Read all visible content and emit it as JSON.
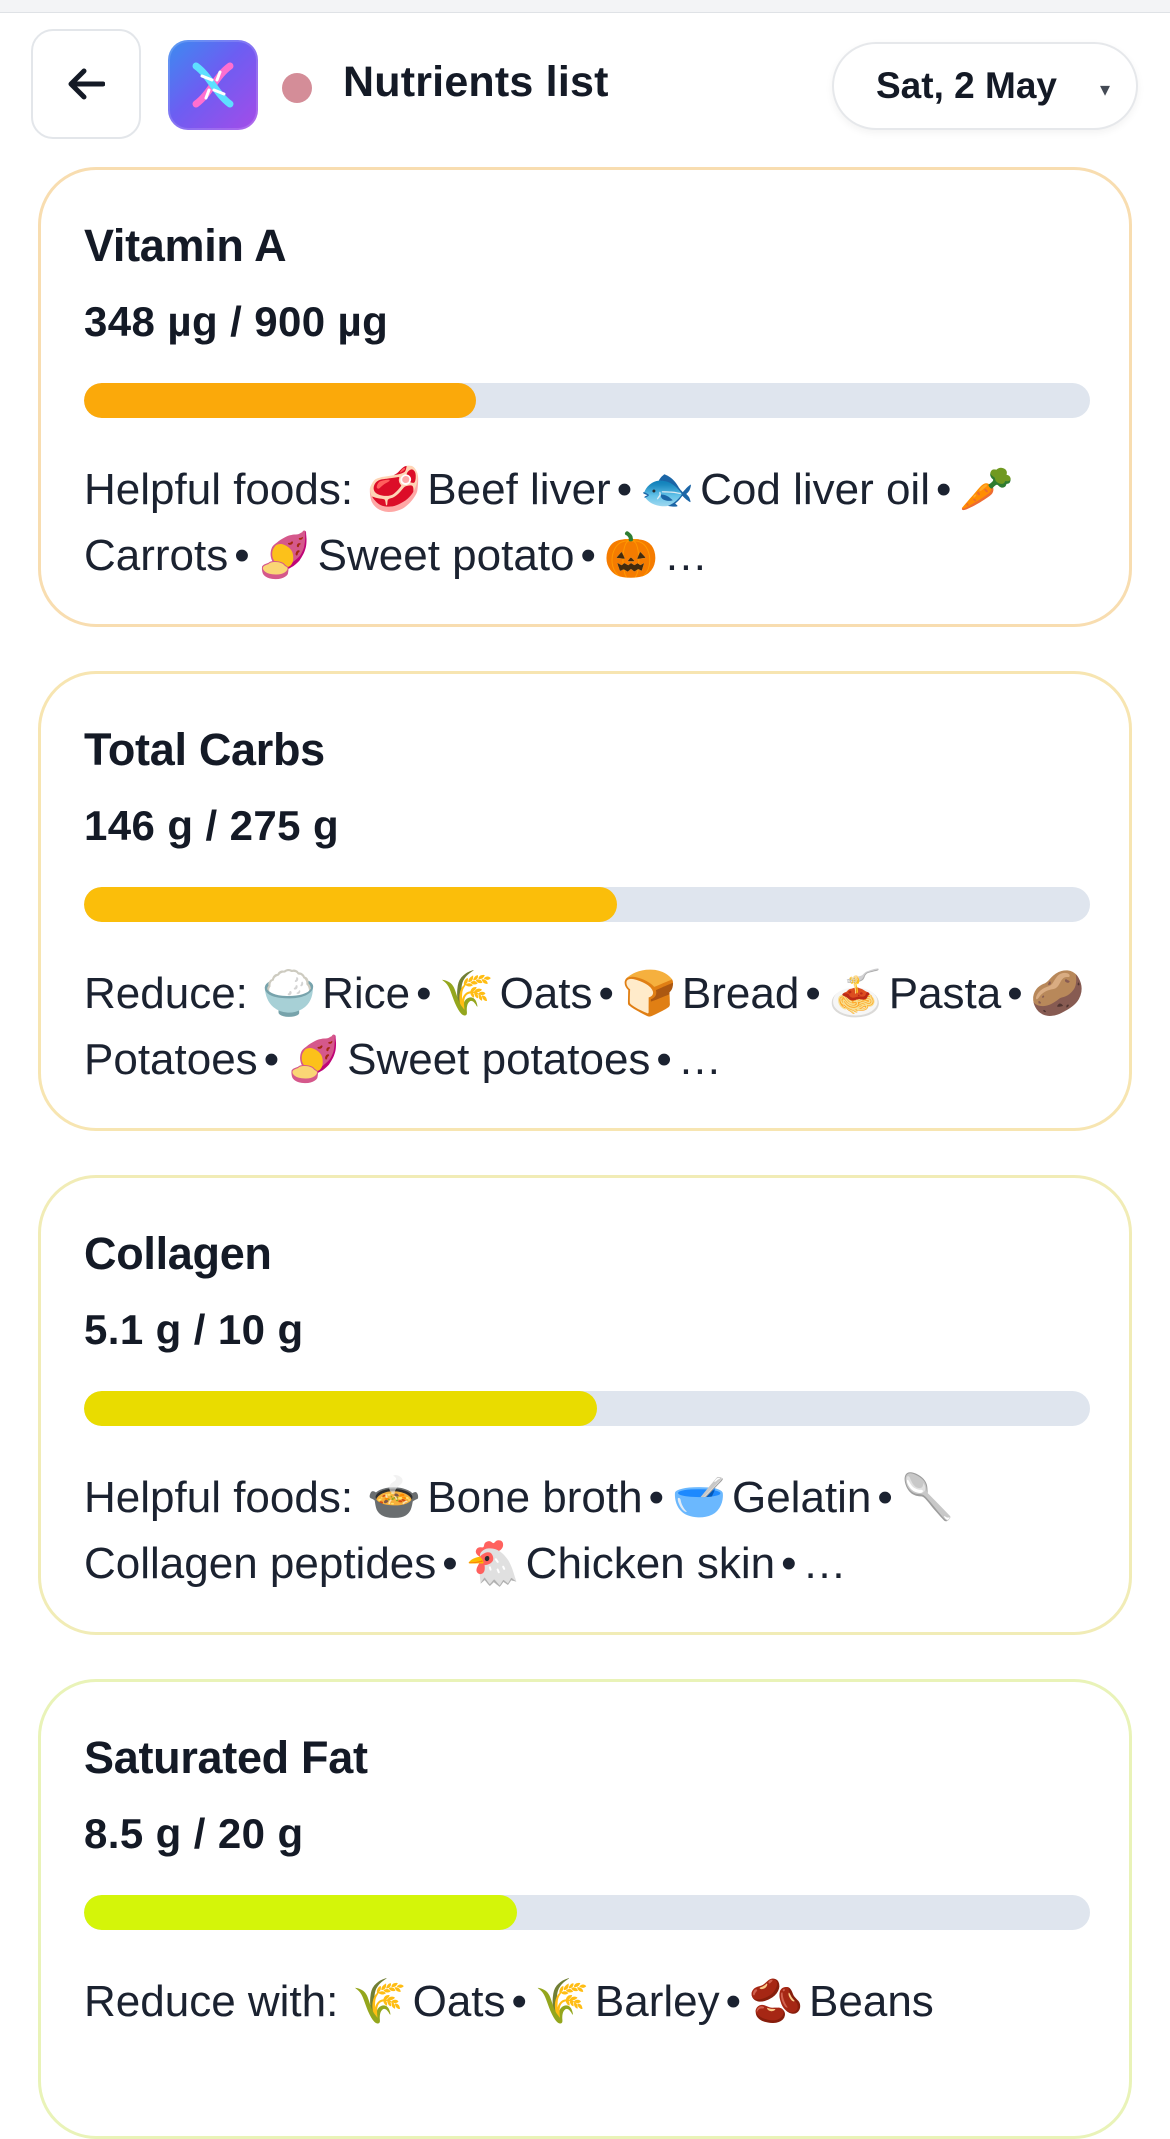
{
  "header": {
    "back_label": "←",
    "title": "Nutrients list",
    "date": "Sat, 2 May",
    "caret": "▾",
    "status_dot_color": "#d48d98",
    "icon": "dna-icon"
  },
  "cards": [
    {
      "name": "Vitamin A",
      "amount": "348 µg / 900 µg",
      "progress": 0.39,
      "bar_color": "#fba90a",
      "border_color": "#f8ddb0",
      "foods_label": "Helpful foods:",
      "foods": [
        {
          "emoji": "🥩",
          "name": "Beef liver"
        },
        {
          "emoji": "🐟",
          "name": "Cod liver oil"
        },
        {
          "emoji": "🥕",
          "name": "Carrots"
        },
        {
          "emoji": "🍠",
          "name": "Sweet potato"
        },
        {
          "emoji": "🎃",
          "name": "…"
        }
      ]
    },
    {
      "name": "Total Carbs",
      "amount": "146 g / 275 g",
      "progress": 0.53,
      "bar_color": "#fbbe0a",
      "border_color": "#f7e5b1",
      "foods_label": "Reduce:",
      "foods": [
        {
          "emoji": "🍚",
          "name": "Rice"
        },
        {
          "emoji": "🌾",
          "name": "Oats"
        },
        {
          "emoji": "🍞",
          "name": "Bread"
        },
        {
          "emoji": "🍝",
          "name": "Pasta"
        },
        {
          "emoji": "🥔",
          "name": "Potatoes"
        },
        {
          "emoji": "🍠",
          "name": "Sweet potatoes"
        },
        {
          "emoji": "",
          "name": "…"
        }
      ]
    },
    {
      "name": "Collagen",
      "amount": "5.1 g / 10 g",
      "progress": 0.51,
      "bar_color": "#e9dc00",
      "border_color": "#f1ecb6",
      "foods_label": "Helpful foods:",
      "foods": [
        {
          "emoji": "🍲",
          "name": "Bone broth"
        },
        {
          "emoji": "🥣",
          "name": "Gelatin"
        },
        {
          "emoji": "🥄",
          "name": "Collagen peptides"
        },
        {
          "emoji": "🐔",
          "name": "Chicken skin"
        },
        {
          "emoji": "",
          "name": "…"
        }
      ]
    },
    {
      "name": "Saturated Fat",
      "amount": "8.5 g / 20 g",
      "progress": 0.43,
      "bar_color": "#d4f509",
      "border_color": "#e9f3b8",
      "foods_label": "Reduce with:",
      "foods": [
        {
          "emoji": "🌾",
          "name": "Oats"
        },
        {
          "emoji": "🌾",
          "name": "Barley"
        },
        {
          "emoji": "🫘",
          "name": "Beans"
        }
      ]
    }
  ]
}
